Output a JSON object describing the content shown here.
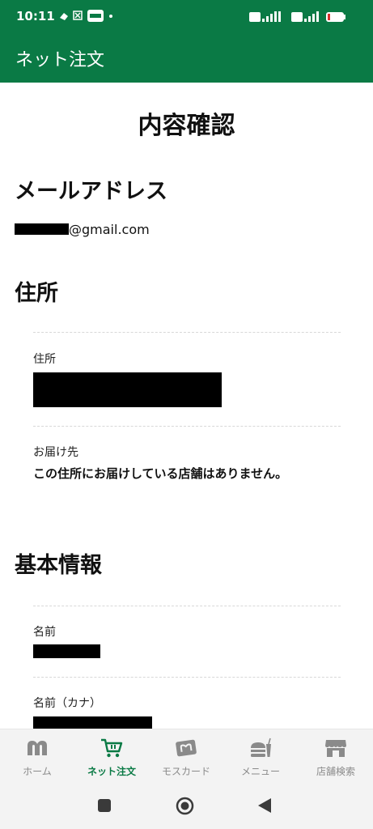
{
  "status_bar": {
    "time": "10:11",
    "battery": "18"
  },
  "app_bar": {
    "title": "ネット注文"
  },
  "page": {
    "title": "内容確認"
  },
  "email_section": {
    "title": "メールアドレス",
    "email_suffix": "@gmail.com"
  },
  "address_section": {
    "title": "住所",
    "address_label": "住所",
    "delivery_label": "お届け先",
    "delivery_value": "この住所にお届けしている店舗はありません。"
  },
  "basic_section": {
    "title": "基本情報",
    "name_label": "名前",
    "name_kana_label": "名前（カナ）"
  },
  "bottom_nav": {
    "items": [
      {
        "label": "ホーム",
        "icon": "mos-logo-icon"
      },
      {
        "label": "ネット注文",
        "icon": "cart-icon"
      },
      {
        "label": "モスカード",
        "icon": "card-icon"
      },
      {
        "label": "メニュー",
        "icon": "burger-drink-icon"
      },
      {
        "label": "店舗検索",
        "icon": "store-icon"
      }
    ],
    "active": "ネット注文"
  },
  "colors": {
    "brand_green": "#0a7a45",
    "nav_inactive": "#8a8a8a",
    "redaction": "#000000"
  }
}
